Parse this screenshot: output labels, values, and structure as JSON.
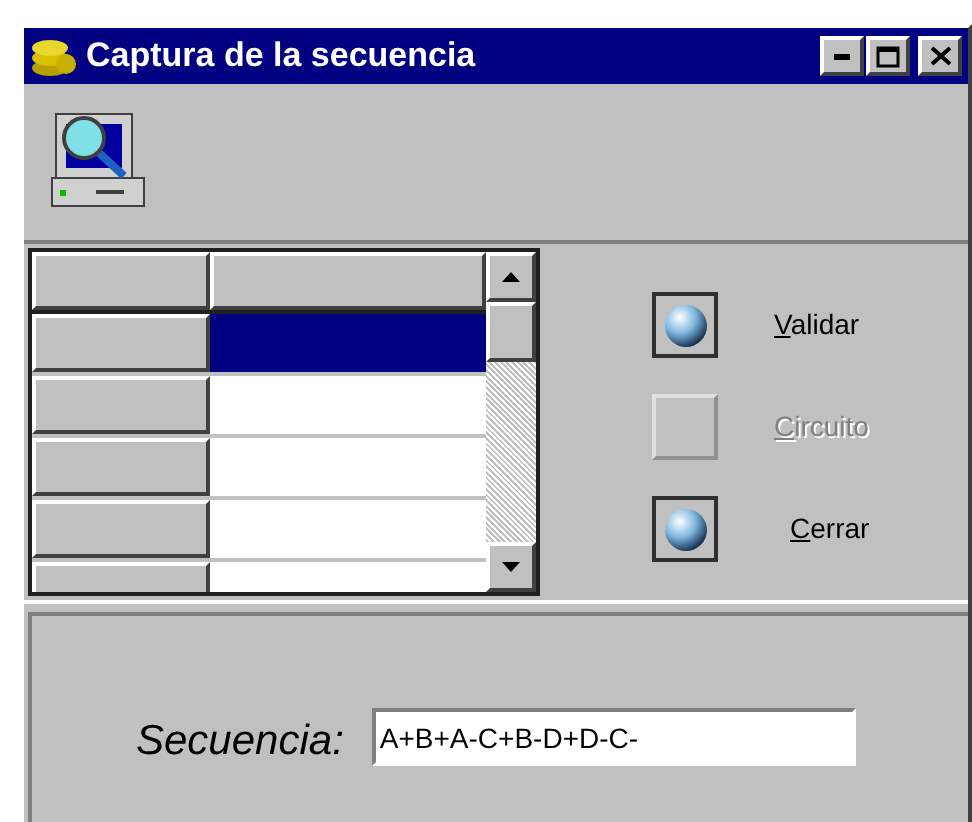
{
  "window": {
    "title": "Captura de la secuencia"
  },
  "grid": {
    "rows": [
      {
        "selected": true
      },
      {
        "selected": false
      },
      {
        "selected": false
      },
      {
        "selected": false
      },
      {
        "selected": false
      }
    ]
  },
  "buttons": [
    {
      "label": "Validar",
      "disabled": false
    },
    {
      "label": "Circuito",
      "disabled": true
    },
    {
      "label": "Cerrar",
      "disabled": false
    }
  ],
  "sequence": {
    "label": "Secuencia:",
    "value": "A+B+A-C+B-D+D-C-"
  }
}
